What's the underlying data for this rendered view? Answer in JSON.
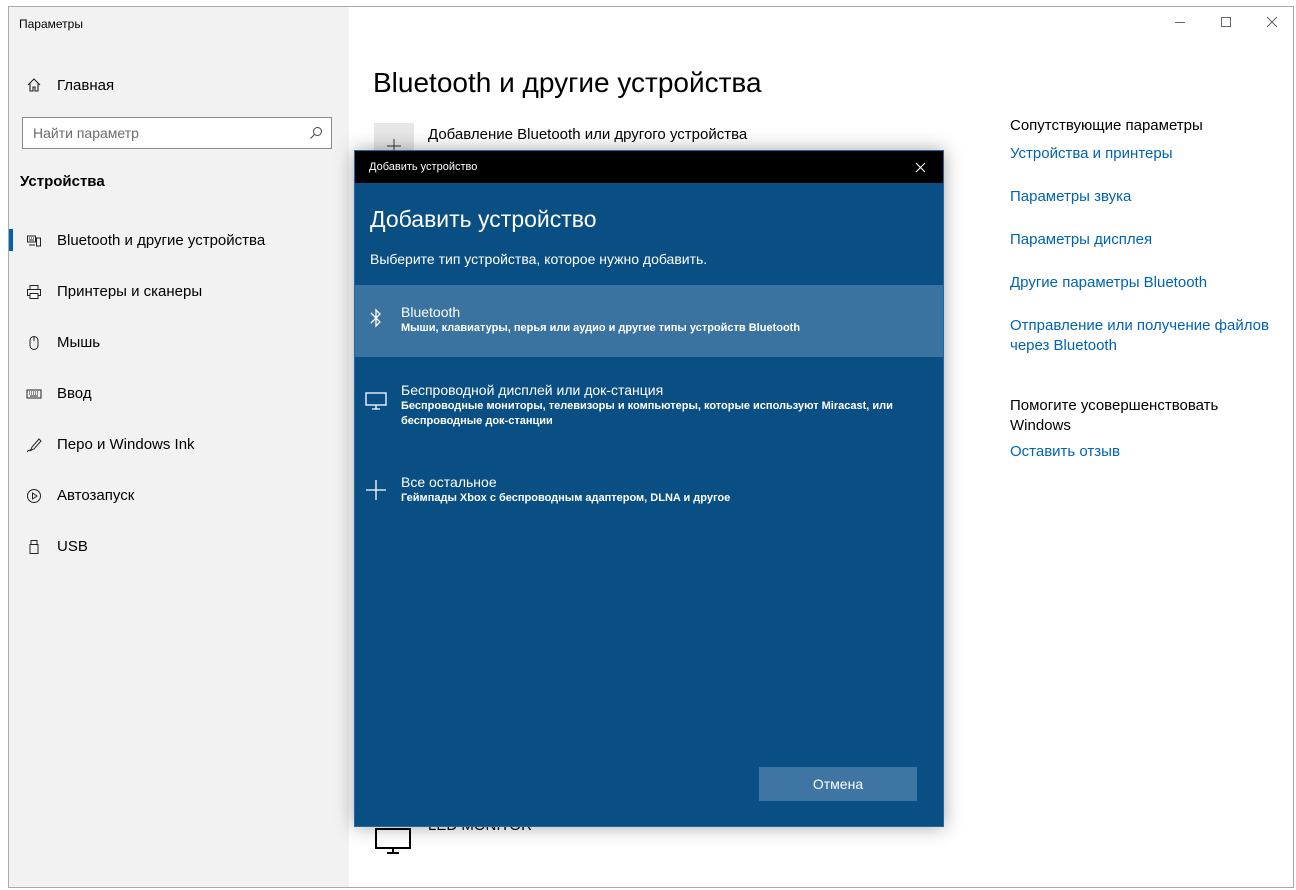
{
  "window": {
    "title": "Параметры"
  },
  "sidebar": {
    "home_label": "Главная",
    "search_placeholder": "Найти параметр",
    "section_title": "Устройства",
    "items": [
      {
        "label": "Bluetooth и другие устройства",
        "icon": "bluetooth-devices-icon",
        "active": true
      },
      {
        "label": "Принтеры и сканеры",
        "icon": "printer-icon"
      },
      {
        "label": "Мышь",
        "icon": "mouse-icon"
      },
      {
        "label": "Ввод",
        "icon": "keyboard-icon"
      },
      {
        "label": "Перо и Windows Ink",
        "icon": "pen-icon"
      },
      {
        "label": "Автозапуск",
        "icon": "autoplay-icon"
      },
      {
        "label": "USB",
        "icon": "usb-icon"
      }
    ]
  },
  "main": {
    "title": "Bluetooth и другие устройства",
    "add_device_label": "Добавление Bluetooth или другого устройства",
    "device_led_monitor": "LED MONITOR"
  },
  "related": {
    "heading": "Сопутствующие параметры",
    "links": [
      "Устройства и принтеры",
      "Параметры звука",
      "Параметры дисплея",
      "Другие параметры Bluetooth",
      "Отправление или получение файлов через Bluetooth"
    ],
    "improve_heading": "Помогите усовершенствовать Windows",
    "feedback_link": "Оставить отзыв"
  },
  "dialog": {
    "titlebar": "Добавить устройство",
    "heading": "Добавить устройство",
    "subtitle": "Выберите тип устройства, которое нужно добавить.",
    "options": [
      {
        "title": "Bluetooth",
        "desc": "Мыши, клавиатуры, перья или аудио и другие типы устройств Bluetooth",
        "icon": "bluetooth-icon",
        "selected": true
      },
      {
        "title": "Беспроводной дисплей или док-станция",
        "desc": "Беспроводные мониторы, телевизоры и компьютеры, которые используют Miracast, или беспроводные док-станции",
        "icon": "monitor-icon"
      },
      {
        "title": "Все остальное",
        "desc": "Геймпады Xbox с беспроводным адаптером, DLNA и другое",
        "icon": "plus-icon"
      }
    ],
    "cancel_label": "Отмена"
  },
  "colors": {
    "accent": "#0063b1",
    "dialog_bg": "#0a4f83",
    "selected_option": "#3a72a0",
    "sidebar_bg": "#f2f2f2"
  }
}
